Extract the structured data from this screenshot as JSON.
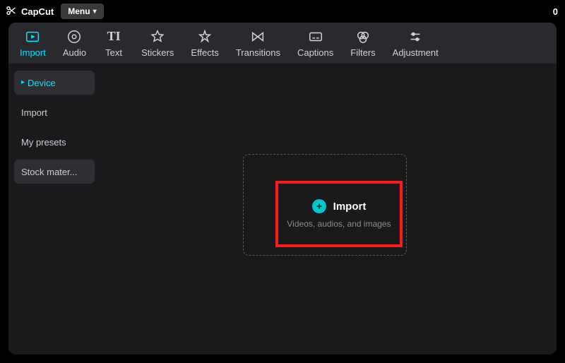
{
  "app": {
    "name": "CapCut",
    "menu_label": "Menu",
    "right_text": "0"
  },
  "toolbar": {
    "items": [
      {
        "label": "Import"
      },
      {
        "label": "Audio"
      },
      {
        "label": "Text"
      },
      {
        "label": "Stickers"
      },
      {
        "label": "Effects"
      },
      {
        "label": "Transitions"
      },
      {
        "label": "Captions"
      },
      {
        "label": "Filters"
      },
      {
        "label": "Adjustment"
      }
    ]
  },
  "sidebar": {
    "items": [
      {
        "label": "Device"
      },
      {
        "label": "Import"
      },
      {
        "label": "My presets"
      },
      {
        "label": "Stock mater..."
      }
    ]
  },
  "import_area": {
    "button_label": "Import",
    "subtitle": "Videos, audios, and images"
  },
  "colors": {
    "accent": "#00E5FF",
    "highlight": "#ff1a1a",
    "plus_bg": "#00C8C8"
  }
}
